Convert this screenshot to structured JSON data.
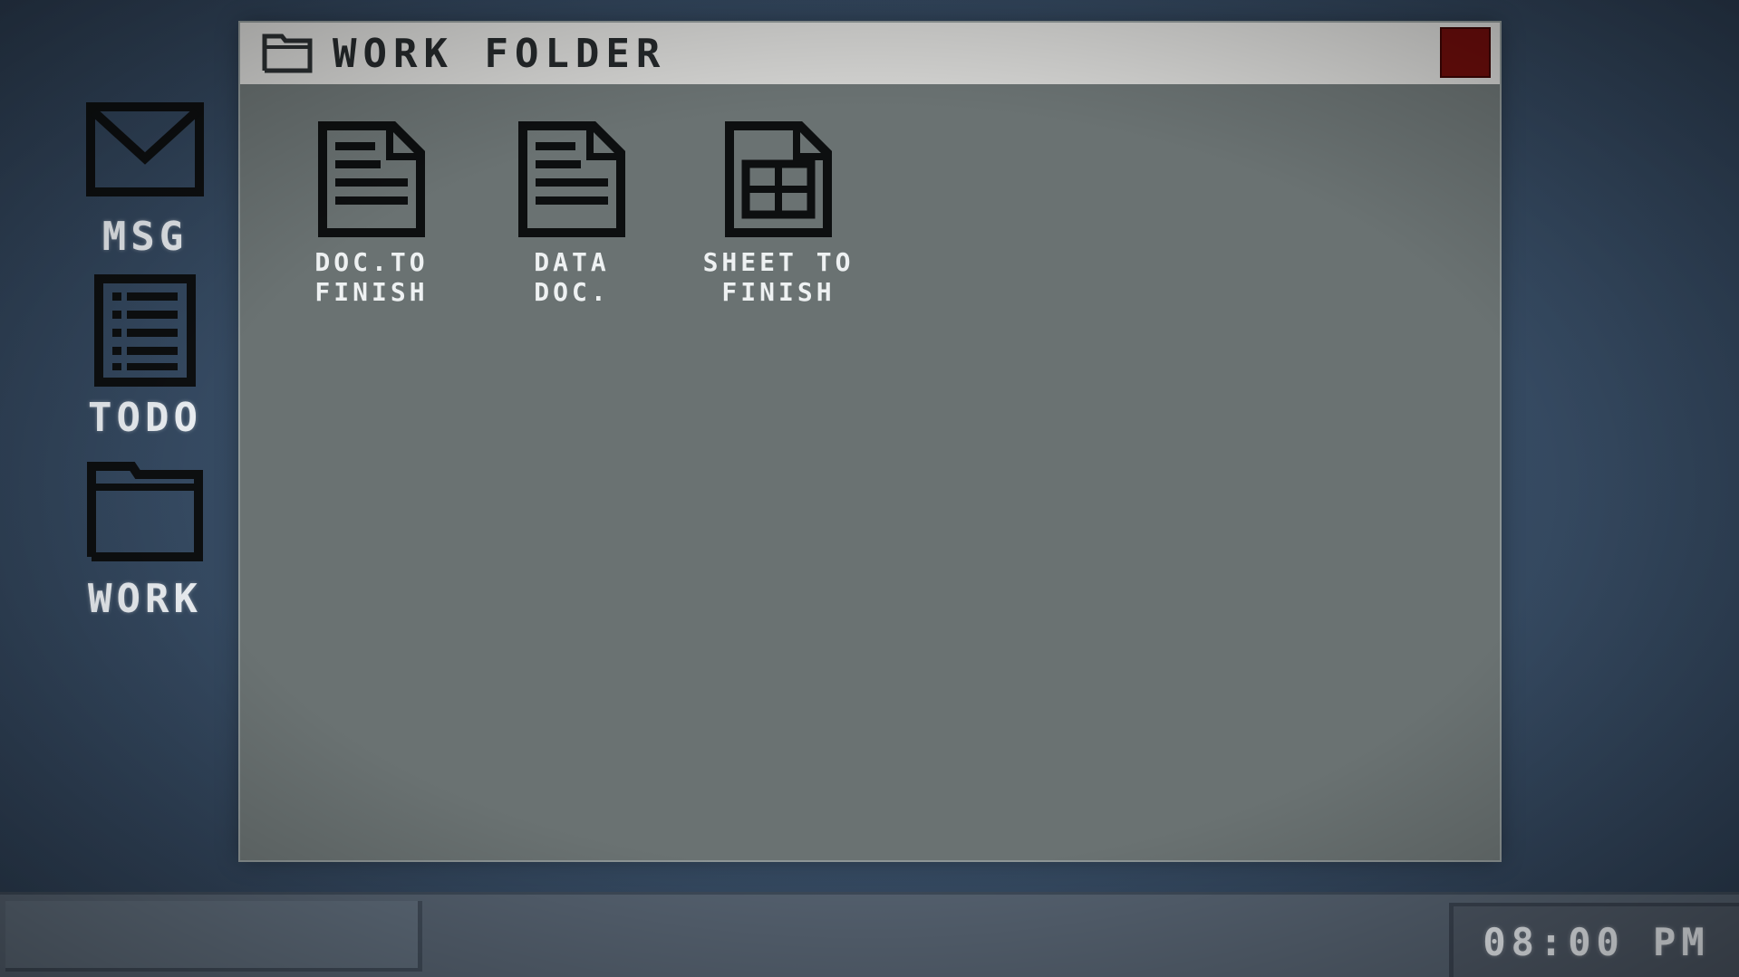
{
  "desktop": {
    "icons": [
      {
        "label": "MSG",
        "icon": "envelope-icon"
      },
      {
        "label": "TODO",
        "icon": "list-icon"
      },
      {
        "label": "WORK",
        "icon": "folder-icon"
      }
    ]
  },
  "window": {
    "title": "WORK FOLDER",
    "title_icon": "folder-icon",
    "close_color": "#6a0d0b",
    "files": [
      {
        "line1": "DOC.TO",
        "line2": "FINISH",
        "icon": "document-icon"
      },
      {
        "line1": "DATA",
        "line2": "DOC.",
        "icon": "document-icon"
      },
      {
        "line1": "SHEET TO",
        "line2": "FINISH",
        "icon": "spreadsheet-icon"
      }
    ]
  },
  "taskbar": {
    "clock": "08:00 PM"
  }
}
